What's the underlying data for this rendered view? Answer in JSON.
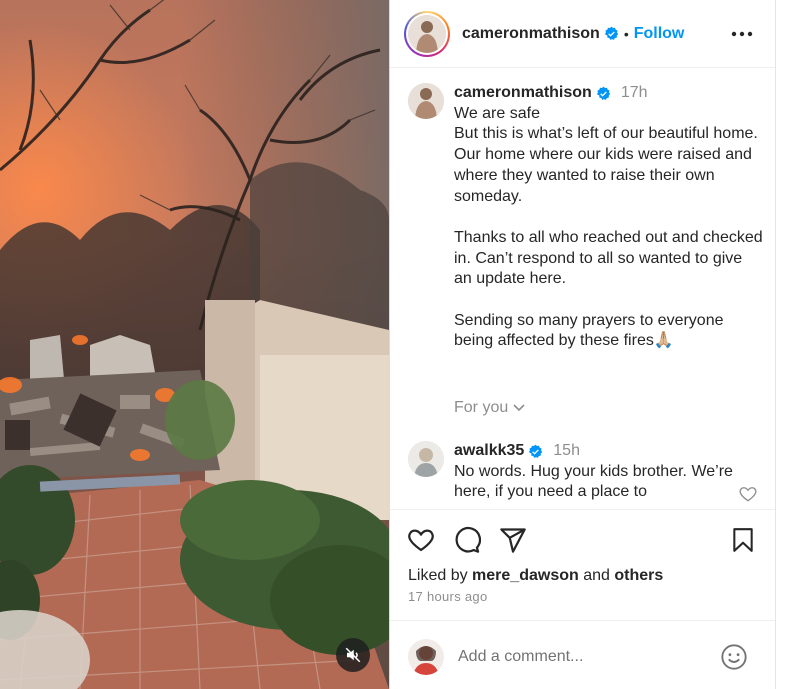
{
  "post": {
    "username": "cameronmathison",
    "follow_label": "Follow",
    "separator": "•"
  },
  "caption": {
    "username": "cameronmathison",
    "time": "17h",
    "lines": [
      "We are safe",
      "But this is what’s left of our beautiful home.",
      "Our home where our kids were raised and where they wanted to raise their own someday.",
      "",
      "Thanks to all who reached out and checked in. Can’t respond to all so wanted to give an update here.",
      "",
      "Sending so many prayers to everyone being affected by these fires🙏🏼"
    ]
  },
  "for_you_label": "For you",
  "comment": {
    "username": "awalkk35",
    "time": "15h",
    "text": "No words. Hug your kids brother. We’re here, if you need a place to"
  },
  "likes": {
    "prefix": "Liked by",
    "user": "mere_dawson",
    "and": "and",
    "others": "others"
  },
  "timestamp": "17 hours ago",
  "add_comment_placeholder": "Add a comment...",
  "icons": {
    "header_more": "more-options-icon",
    "like": "heart-icon",
    "comment": "comment-icon",
    "share": "share-icon",
    "save": "bookmark-icon",
    "mute": "muted-speaker-icon",
    "emoji": "emoji-icon",
    "verified": "verified-badge-icon"
  },
  "colors": {
    "accent": "#0095f6",
    "verified": "#0095f6",
    "muted_text": "#8e8e8e"
  }
}
